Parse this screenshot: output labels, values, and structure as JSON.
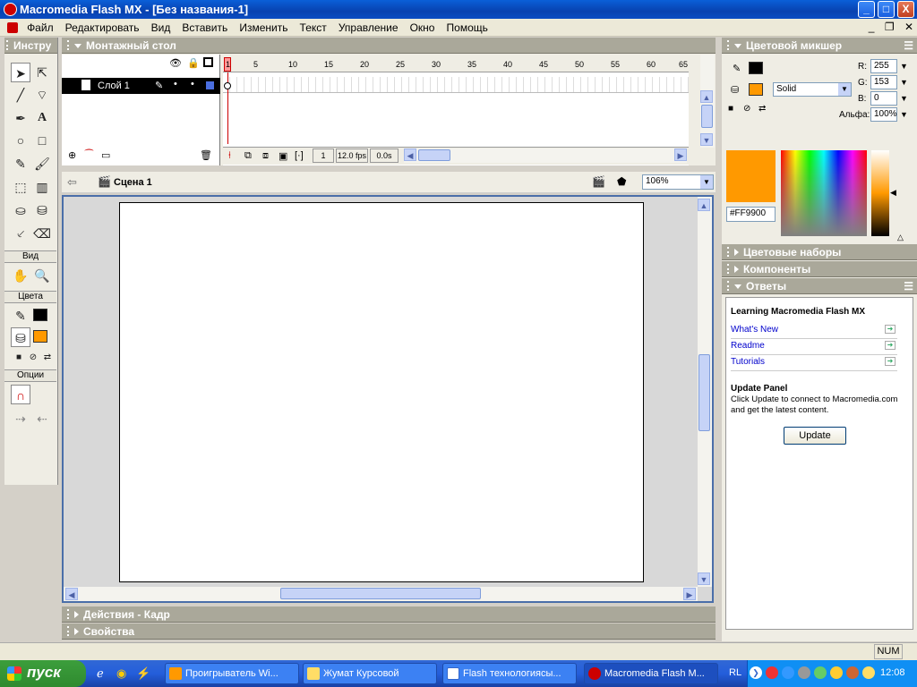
{
  "window": {
    "title": "Macromedia Flash MX - [Без названия-1]",
    "minimize": "_",
    "maximize": "□",
    "close": "X"
  },
  "menu": {
    "items": [
      "Файл",
      "Редактировать",
      "Вид",
      "Вставить",
      "Изменить",
      "Текст",
      "Управление",
      "Окно",
      "Помощь"
    ]
  },
  "tools_panel": {
    "title": "Инстру",
    "section_view": "Вид",
    "section_colors": "Цвета",
    "section_options": "Опции",
    "stroke_color": "#000000",
    "fill_color": "#FF9900"
  },
  "timeline": {
    "title": "Монтажный стол",
    "ruler_ticks": [
      "1",
      "5",
      "10",
      "15",
      "20",
      "25",
      "30",
      "35",
      "40",
      "45",
      "50",
      "55",
      "60",
      "65"
    ],
    "layer_name": "Слой 1",
    "current_frame": "1",
    "frame_rate": "12.0 fps",
    "elapsed_time": "0.0s"
  },
  "scene": {
    "name": "Сцена 1",
    "zoom": "106%"
  },
  "bottom_panels": {
    "actions": "Действия - Кадр",
    "properties": "Свойства"
  },
  "color_mixer": {
    "title": "Цветовой микшер",
    "r_label": "R:",
    "r_value": "255",
    "g_label": "G:",
    "g_value": "153",
    "b_label": "B:",
    "b_value": "0",
    "alpha_label": "Альфа:",
    "alpha_value": "100%",
    "fill_type": "Solid",
    "hex_value": "#FF9900",
    "swatch_color": "#FF9900"
  },
  "collapsed_panels": {
    "color_swatches": "Цветовые наборы",
    "components": "Компоненты"
  },
  "answers": {
    "title": "Ответы",
    "heading": "Learning Macromedia Flash MX",
    "links": [
      "What's New",
      "Readme",
      "Tutorials"
    ],
    "update_title": "Update Panel",
    "update_text_1": "Click Update to connect to Macromedia.com",
    "update_text_2": "and get the latest content.",
    "update_button": "Update"
  },
  "statusbar": {
    "num": "NUM"
  },
  "taskbar": {
    "start": "пуск",
    "tasks": [
      "Проигрыватель Wi...",
      "Жумат Курсовой",
      "Flash технологиясы...",
      "Macromedia Flash M..."
    ],
    "lang": "RL",
    "clock": "12:08"
  }
}
